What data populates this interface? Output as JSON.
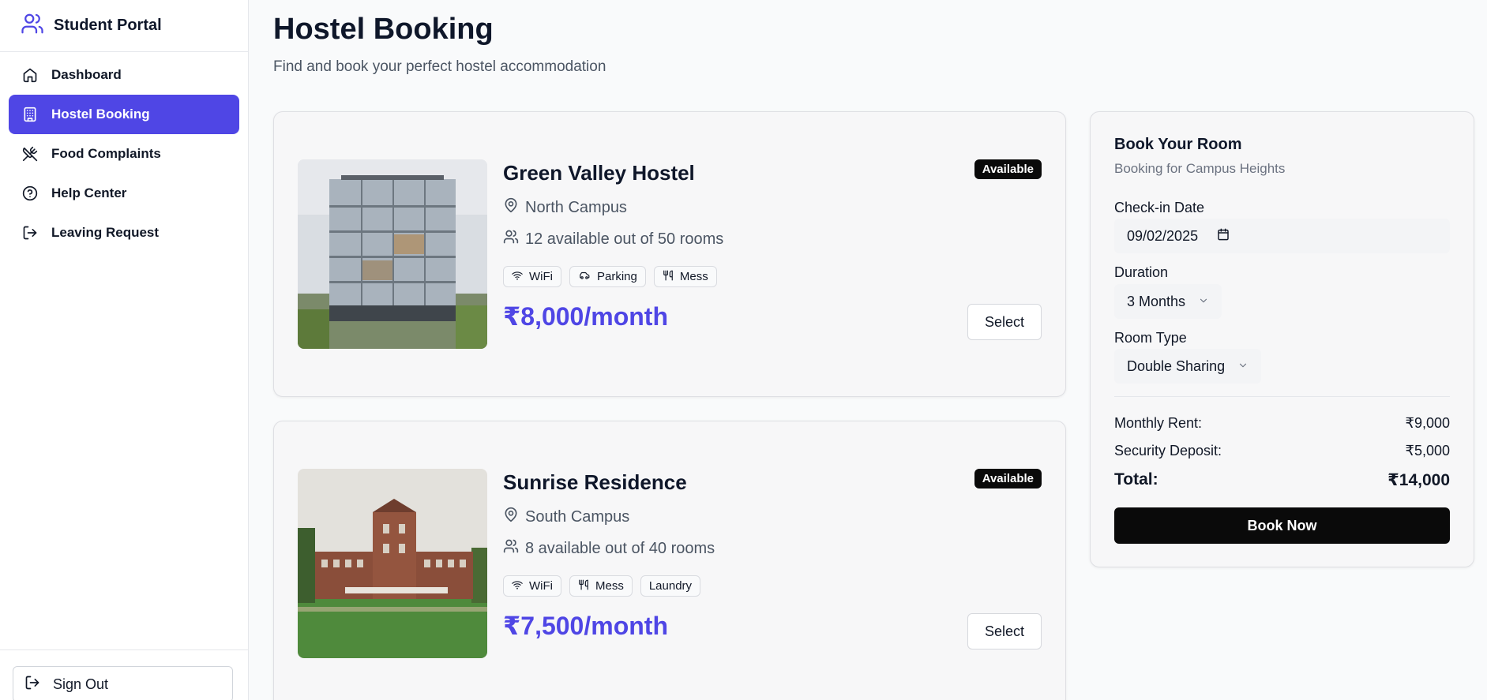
{
  "app": {
    "title": "Student Portal"
  },
  "sidebar": {
    "items": [
      {
        "label": "Dashboard",
        "icon": "home-icon"
      },
      {
        "label": "Hostel Booking",
        "icon": "building-icon",
        "active": true
      },
      {
        "label": "Food Complaints",
        "icon": "utensils-crossed-icon"
      },
      {
        "label": "Help Center",
        "icon": "help-circle-icon"
      },
      {
        "label": "Leaving Request",
        "icon": "log-out-icon"
      }
    ],
    "signout_label": "Sign Out"
  },
  "page": {
    "title": "Hostel Booking",
    "subtitle": "Find and book your perfect hostel accommodation"
  },
  "hostels": [
    {
      "name": "Green Valley Hostel",
      "location": "North Campus",
      "rooms": "12 available out of 50 rooms",
      "amenities": [
        "WiFi",
        "Parking",
        "Mess"
      ],
      "price": "₹8,000/month",
      "status": "Available",
      "select_label": "Select"
    },
    {
      "name": "Sunrise Residence",
      "location": "South Campus",
      "rooms": "8 available out of 40 rooms",
      "amenities": [
        "WiFi",
        "Mess",
        "Laundry"
      ],
      "price": "₹7,500/month",
      "status": "Available",
      "select_label": "Select"
    }
  ],
  "booking": {
    "title": "Book Your Room",
    "subtitle": "Booking for Campus Heights",
    "checkin_label": "Check-in Date",
    "checkin_value": "09/02/2025",
    "duration_label": "Duration",
    "duration_value": "3 Months",
    "roomtype_label": "Room Type",
    "roomtype_value": "Double Sharing",
    "monthly_rent_label": "Monthly Rent:",
    "monthly_rent_value": "₹9,000",
    "deposit_label": "Security Deposit:",
    "deposit_value": "₹5,000",
    "total_label": "Total:",
    "total_value": "₹14,000",
    "book_label": "Book Now"
  },
  "colors": {
    "accent": "#4f46e5",
    "primary_button": "#0a0a0a"
  }
}
